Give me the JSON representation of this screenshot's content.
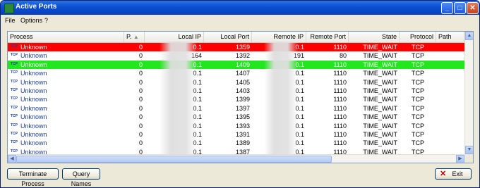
{
  "window": {
    "title": "Active Ports",
    "controls": {
      "minimize": "_",
      "maximize": "□",
      "close": "✕"
    }
  },
  "menu": [
    "File",
    "Options",
    "?"
  ],
  "columns": [
    "Process",
    "P.",
    "Local IP",
    "Local Port",
    "Remote IP",
    "Remote Port",
    "State",
    "Protocol",
    "Path"
  ],
  "sort_indicator": "▲",
  "row_icon_text": "TCP",
  "rows": [
    {
      "process": "Unknown",
      "pid": "0",
      "local_ip": "0.1",
      "local_port": "1359",
      "remote_ip": "0.1",
      "remote_port": "1110",
      "state": "TIME_WAIT",
      "protocol": "TCP",
      "path": "",
      "highlight": "red"
    },
    {
      "process": "Unknown",
      "pid": "0",
      "local_ip": "164",
      "local_port": "1392",
      "remote_ip": "191",
      "remote_port": "80",
      "state": "TIME_WAIT",
      "protocol": "TCP",
      "path": "",
      "highlight": "none"
    },
    {
      "process": "Unknown",
      "pid": "0",
      "local_ip": "0.1",
      "local_port": "1409",
      "remote_ip": "0.1",
      "remote_port": "1110",
      "state": "TIME_WAIT",
      "protocol": "TCP",
      "path": "",
      "highlight": "green"
    },
    {
      "process": "Unknown",
      "pid": "0",
      "local_ip": "0.1",
      "local_port": "1407",
      "remote_ip": "0.1",
      "remote_port": "1110",
      "state": "TIME_WAIT",
      "protocol": "TCP",
      "path": "",
      "highlight": "none"
    },
    {
      "process": "Unknown",
      "pid": "0",
      "local_ip": "0.1",
      "local_port": "1405",
      "remote_ip": "0.1",
      "remote_port": "1110",
      "state": "TIME_WAIT",
      "protocol": "TCP",
      "path": "",
      "highlight": "none"
    },
    {
      "process": "Unknown",
      "pid": "0",
      "local_ip": "0.1",
      "local_port": "1403",
      "remote_ip": "0.1",
      "remote_port": "1110",
      "state": "TIME_WAIT",
      "protocol": "TCP",
      "path": "",
      "highlight": "none"
    },
    {
      "process": "Unknown",
      "pid": "0",
      "local_ip": "0.1",
      "local_port": "1399",
      "remote_ip": "0.1",
      "remote_port": "1110",
      "state": "TIME_WAIT",
      "protocol": "TCP",
      "path": "",
      "highlight": "none"
    },
    {
      "process": "Unknown",
      "pid": "0",
      "local_ip": "0.1",
      "local_port": "1397",
      "remote_ip": "0.1",
      "remote_port": "1110",
      "state": "TIME_WAIT",
      "protocol": "TCP",
      "path": "",
      "highlight": "none"
    },
    {
      "process": "Unknown",
      "pid": "0",
      "local_ip": "0.1",
      "local_port": "1395",
      "remote_ip": "0.1",
      "remote_port": "1110",
      "state": "TIME_WAIT",
      "protocol": "TCP",
      "path": "",
      "highlight": "none"
    },
    {
      "process": "Unknown",
      "pid": "0",
      "local_ip": "0.1",
      "local_port": "1393",
      "remote_ip": "0.1",
      "remote_port": "1110",
      "state": "TIME_WAIT",
      "protocol": "TCP",
      "path": "",
      "highlight": "none"
    },
    {
      "process": "Unknown",
      "pid": "0",
      "local_ip": "0.1",
      "local_port": "1391",
      "remote_ip": "0.1",
      "remote_port": "1110",
      "state": "TIME_WAIT",
      "protocol": "TCP",
      "path": "",
      "highlight": "none"
    },
    {
      "process": "Unknown",
      "pid": "0",
      "local_ip": "0.1",
      "local_port": "1389",
      "remote_ip": "0.1",
      "remote_port": "1110",
      "state": "TIME_WAIT",
      "protocol": "TCP",
      "path": "",
      "highlight": "none"
    },
    {
      "process": "Unknown",
      "pid": "0",
      "local_ip": "0.1",
      "local_port": "1387",
      "remote_ip": "0.1",
      "remote_port": "1110",
      "state": "TIME_WAIT",
      "protocol": "TCP",
      "path": "",
      "highlight": "none"
    }
  ],
  "row_colors": {
    "red": {
      "background": "#ff0000",
      "text": "#ffffff"
    },
    "green": {
      "background": "#22e61e",
      "text": "#ffffff"
    },
    "none": {
      "background": "#ffffff",
      "text": "#000000"
    }
  },
  "process_text_color": "#1c3f9e",
  "scrollbar": {
    "up_arrow": "▲",
    "down_arrow": "▼",
    "left_arrow": "◀",
    "right_arrow": "▶"
  },
  "buttons": {
    "terminate": "Terminate Process",
    "query": "Query Names",
    "exit": "Exit",
    "exit_icon": "✕"
  }
}
